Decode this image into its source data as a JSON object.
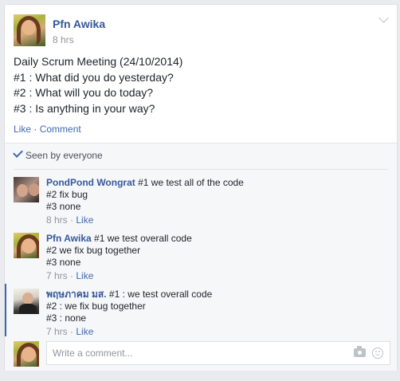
{
  "post": {
    "author": "Pfn Awika",
    "time": "8 hrs",
    "lines": [
      "Daily Scrum Meeting (24/10/2014)",
      "#1 : What did you do yesterday?",
      "#2 : What will you do today?",
      "#3 : Is anything in your way?"
    ],
    "like_label": "Like",
    "separator": " · ",
    "comment_label": "Comment"
  },
  "seen": {
    "text": "Seen by everyone"
  },
  "comments": [
    {
      "author": "PondPond Wongrat",
      "text": "#1 we test all of the code",
      "line2": "#2 fix bug",
      "line3": "#3 none",
      "time": "8 hrs",
      "like_label": "Like"
    },
    {
      "author": "Pfn Awika",
      "text": "#1 we test overall code",
      "line2": "#2 we fix bug together",
      "line3": "#3 none",
      "time": "7 hrs",
      "like_label": "Like"
    },
    {
      "author": "พฤษภาคม มส.",
      "text": "#1 : we test overall code",
      "line2": "#2 : we fix bug together",
      "line3": "#3 : none",
      "time": "7 hrs",
      "like_label": "Like"
    }
  ],
  "composer": {
    "placeholder": "Write a comment..."
  },
  "colors": {
    "link": "#365899",
    "accent": "#4267b2",
    "muted": "#90949c"
  }
}
